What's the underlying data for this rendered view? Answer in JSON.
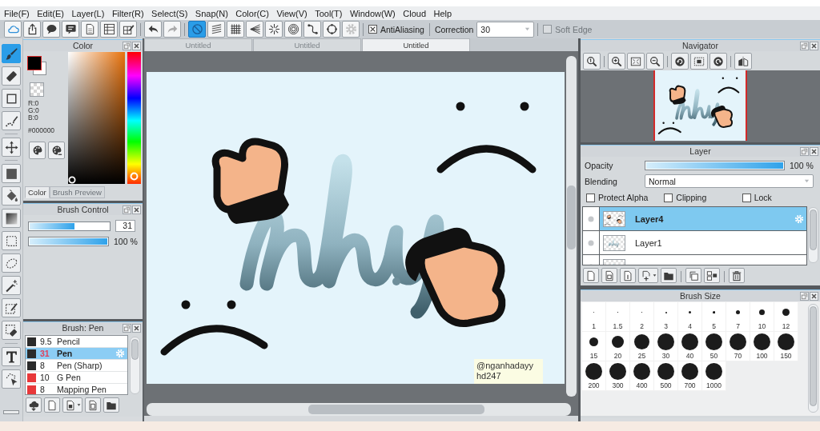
{
  "menu_bar": {
    "items": [
      "File(F)",
      "Edit(E)",
      "Layer(L)",
      "Filter(R)",
      "Select(S)",
      "Snap(N)",
      "Color(C)",
      "View(V)",
      "Tool(T)",
      "Window(W)",
      "Cloud",
      "Help"
    ]
  },
  "toolbar": {
    "buttons": [
      {
        "selected": false,
        "disabled": false
      },
      {
        "selected": false,
        "disabled": false
      },
      {
        "selected": false,
        "disabled": false
      },
      {
        "selected": false,
        "disabled": false
      },
      {
        "selected": false,
        "disabled": false
      },
      {
        "selected": false,
        "disabled": false
      },
      {
        "selected": false,
        "disabled": false
      },
      {
        "selected": false,
        "disabled": false
      },
      {
        "selected": false,
        "disabled": true
      },
      {
        "selected": true,
        "disabled": false
      },
      {
        "selected": false,
        "disabled": false
      },
      {
        "selected": false,
        "disabled": false
      },
      {
        "selected": false,
        "disabled": false
      },
      {
        "selected": false,
        "disabled": false
      },
      {
        "selected": false,
        "disabled": false
      },
      {
        "selected": false,
        "disabled": false
      },
      {
        "selected": false,
        "disabled": false
      },
      {
        "selected": false,
        "disabled": true
      }
    ],
    "anti_aliasing": {
      "label": "AntiAliasing",
      "checked": true
    },
    "correction": {
      "label": "Correction",
      "value": "30"
    },
    "soft_edge": {
      "label": "Soft Edge",
      "checked": false,
      "disabled": true
    }
  },
  "tools": [
    {
      "selected": true
    },
    {
      "selected": false
    },
    {
      "selected": false
    },
    {
      "selected": false
    },
    {
      "selected": false
    },
    {
      "selected": false
    },
    {
      "selected": false
    },
    {
      "selected": false
    },
    {
      "selected": false
    },
    {
      "selected": false
    },
    {
      "selected": false
    },
    {
      "selected": false
    },
    {
      "selected": false
    },
    {
      "selected": false
    },
    {
      "selected": false
    }
  ],
  "color_panel": {
    "title": "Color",
    "rgb": [
      "R:0",
      "G:0",
      "B:0"
    ],
    "hex": "#000000",
    "tabs": [
      {
        "label": "Color",
        "selected": true
      },
      {
        "label": "Brush Preview",
        "selected": false
      }
    ]
  },
  "brush_control": {
    "title": "Brush Control",
    "sliders": [
      {
        "level": 0.57,
        "value": "31"
      },
      {
        "level": 1,
        "value": "100 %"
      }
    ]
  },
  "brush_list": {
    "title": "Brush: Pen",
    "items": [
      {
        "size": "9.5",
        "name": "Pencil",
        "color": "#2b2b2b",
        "selected": false
      },
      {
        "size": "31",
        "name": "Pen",
        "color": "#2b2b2b",
        "selected": true
      },
      {
        "size": "8",
        "name": "Pen (Sharp)",
        "color": "#2b2b2b",
        "selected": false
      },
      {
        "size": "10",
        "name": "G Pen",
        "color": "#e8383a",
        "selected": false
      },
      {
        "size": "8",
        "name": "Mapping Pen",
        "color": "#e8383a",
        "selected": false
      }
    ]
  },
  "document_tabs": [
    {
      "label": "Untitled",
      "selected": false
    },
    {
      "label": "Untitled",
      "selected": false
    },
    {
      "label": "Untitled",
      "selected": true
    }
  ],
  "canvas": {
    "signature": [
      "@nganhadayy",
      "hd247"
    ]
  },
  "navigator": {
    "title": "Navigator"
  },
  "layer_panel": {
    "title": "Layer",
    "opacity": {
      "label": "Opacity",
      "level": 1,
      "value": "100 %"
    },
    "blending": {
      "label": "Blending",
      "value": "Normal"
    },
    "options": [
      {
        "label": "Protect Alpha",
        "checked": false
      },
      {
        "label": "Clipping",
        "checked": false
      },
      {
        "label": "Lock",
        "checked": false
      }
    ],
    "layers": [
      {
        "name": "Layer4",
        "selected": true
      },
      {
        "name": "Layer1",
        "selected": false
      },
      {
        "selected": false
      }
    ]
  },
  "brush_size": {
    "title": "Brush Size",
    "sizes": [
      "1",
      "1.5",
      "2",
      "3",
      "4",
      "5",
      "7",
      "10",
      "12",
      "15",
      "20",
      "25",
      "30",
      "40",
      "50",
      "70",
      "100",
      "150",
      "200",
      "300",
      "400",
      "500",
      "700",
      "1000"
    ]
  }
}
